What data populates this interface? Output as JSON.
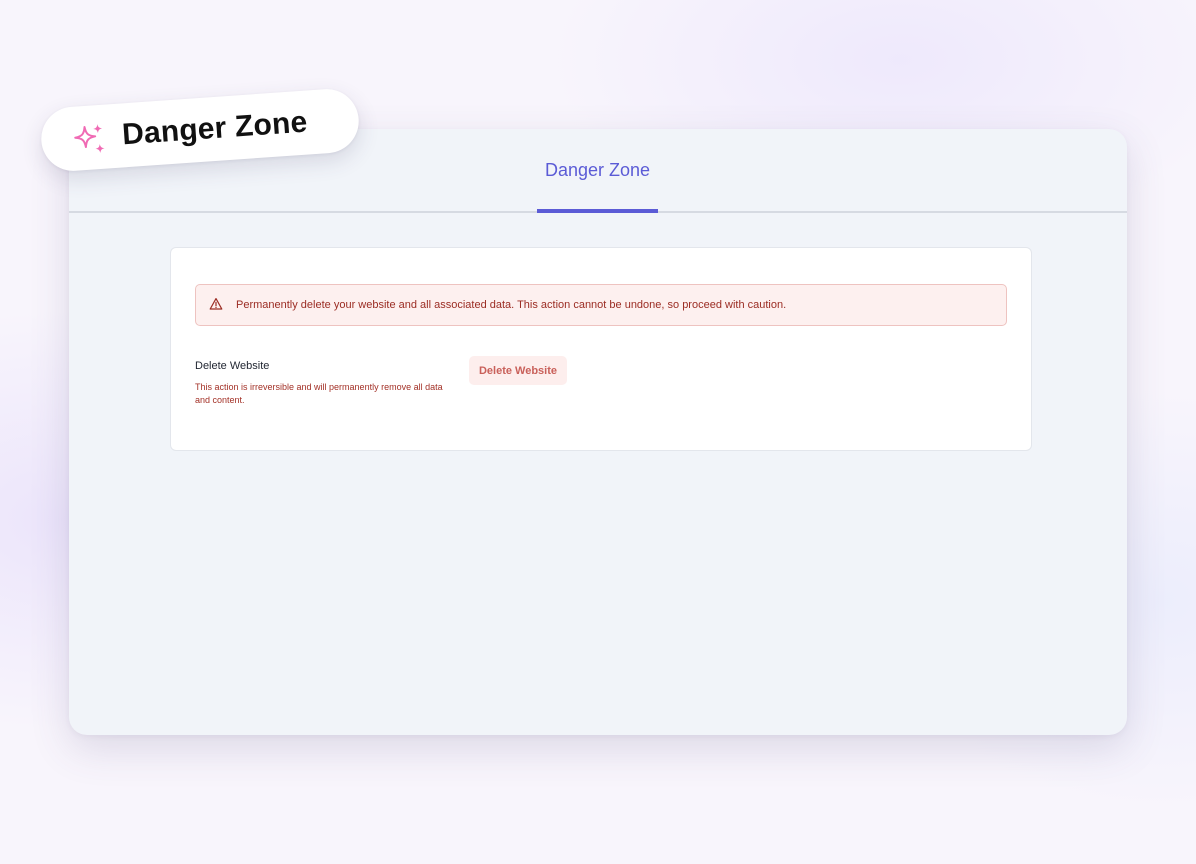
{
  "badge": {
    "label": "Danger Zone",
    "icon": "sparkles-icon",
    "icon_color": "#f06ab4"
  },
  "tabs": [
    {
      "label": "Danger Zone",
      "active": true
    }
  ],
  "alert": {
    "icon": "warning-triangle-icon",
    "text": "Permanently delete your website and all associated data. This action cannot be undone, so proceed with caution."
  },
  "delete_section": {
    "title": "Delete Website",
    "description": "This action is irreversible and will permanently remove all data and content.",
    "button_label": "Delete Website"
  },
  "colors": {
    "accent": "#5b5bd6",
    "danger_text": "#9b2c23",
    "danger_bg": "#fdf0ef",
    "danger_border": "#eec3c0",
    "button_text": "#c9605a",
    "button_bg": "#fdeeed"
  }
}
